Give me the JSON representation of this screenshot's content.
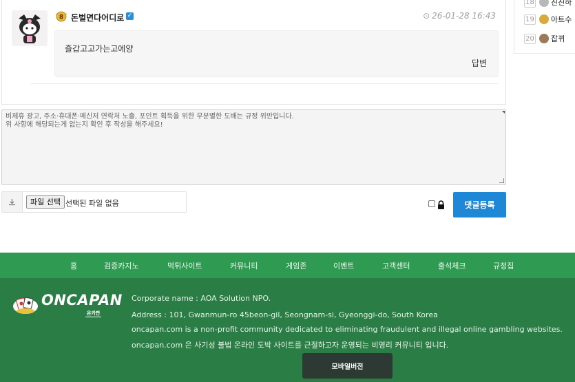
{
  "comment": {
    "nickname": "돈벌면다어디로",
    "level": "8",
    "datetime": "26-01-28 16:43",
    "text": "즐갑고고가는고에양",
    "reply_label": "답변"
  },
  "compose": {
    "placeholder": "비제휴 광고, 주소·휴대폰·메신저 연락처 노출, 포인트 획득을 위한 무분별한 도배는 규정 위반입니다.\n위 사항에 해당되는게 없는지 확인 후 작성을 해주세요!",
    "file_button_label": "파일 선택",
    "file_status": "선택된 파일 없음",
    "submit_label": "댓글등록"
  },
  "ranking": {
    "items": [
      {
        "rank": "18",
        "name": "친친하",
        "icon_color": "#b8b8b8"
      },
      {
        "rank": "19",
        "name": "아트수",
        "icon_color": "#d9a93a"
      },
      {
        "rank": "20",
        "name": "잡뀌",
        "icon_color": "#9a7a5a"
      }
    ]
  },
  "footer": {
    "nav": [
      "홈",
      "검증카지노",
      "먹튀사이트",
      "커뮤니티",
      "게임존",
      "이벤트",
      "고객센터",
      "출석체크",
      "규정집"
    ],
    "logo_text": "ONCAPAN",
    "logo_sub": "온카판",
    "lines": [
      "Corporate name : AOA Solution NPO.",
      "Address : 101, Gwanmun-ro 45beon-gil, Seongnam-si, Gyeonggi-do, South Korea",
      "oncapan.com is a non-profit community dedicated to eliminating fraudulent and illegal online gambling websites.",
      "oncapan.com 은 사기성 불법 온라인 도박 사이트를 근절하고자 운영되는 비영리 커뮤니티 입니다."
    ],
    "mobile_label": "모바일버전"
  },
  "colors": {
    "footer_nav_bg": "#2f9a52",
    "footer_bg": "#2a7d44",
    "submit_bg": "#1e88d7"
  }
}
